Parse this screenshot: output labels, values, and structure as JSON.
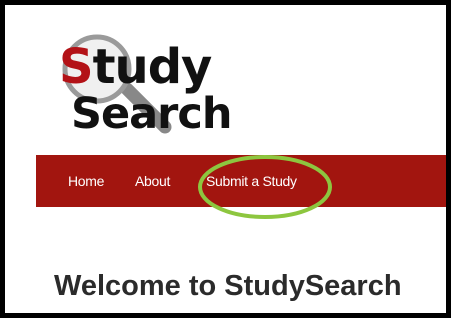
{
  "logo": {
    "line1_first": "S",
    "line1_rest": "tudy",
    "line2": "Search",
    "colors": {
      "accent": "#b31217",
      "text": "#111111"
    },
    "icon": "magnifying-glass-icon"
  },
  "nav": {
    "background": "#a2150f",
    "items": [
      {
        "label": "Home"
      },
      {
        "label": "About"
      },
      {
        "label": "Submit a Study"
      }
    ]
  },
  "annotation": {
    "color": "#8dc63f",
    "target": "Submit a Study"
  },
  "main": {
    "heading": "Welcome to StudySearch"
  }
}
